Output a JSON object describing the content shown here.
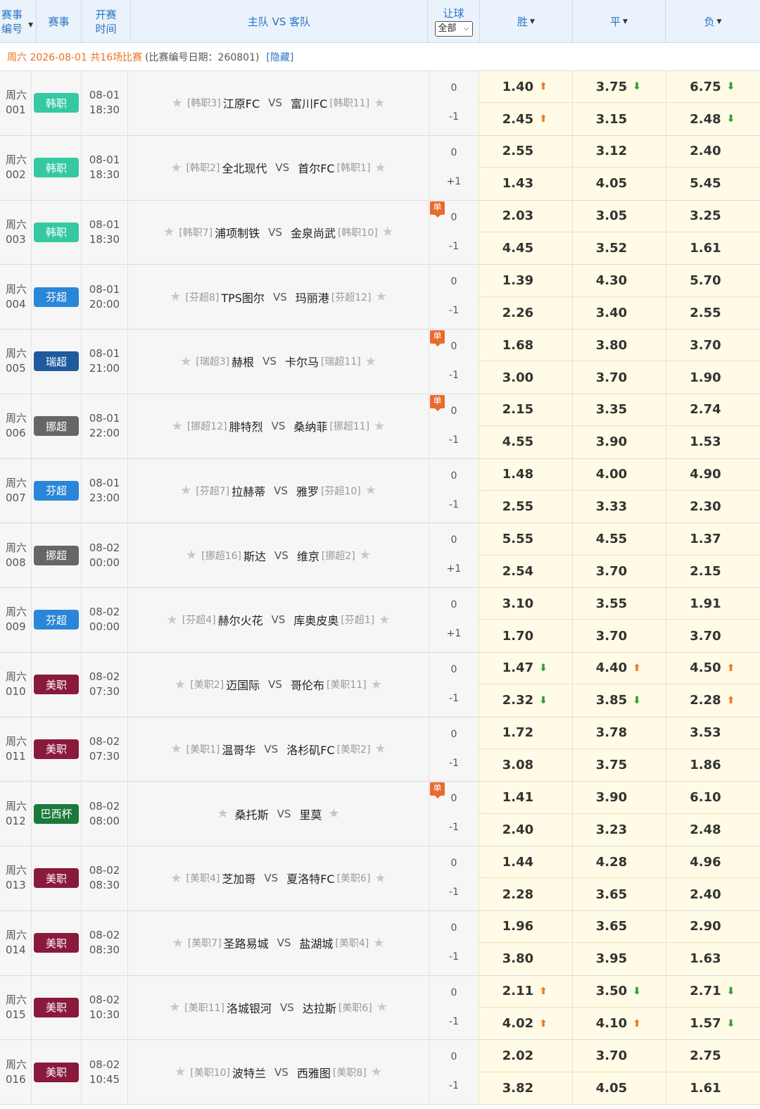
{
  "header": {
    "col_id": "赛事编号",
    "col_league": "赛事",
    "col_time": "开赛时间",
    "col_teams": "主队 VS 客队",
    "col_handicap": "让球",
    "handicap_select": "全部",
    "col_win": "胜",
    "col_draw": "平",
    "col_lose": "负"
  },
  "date_bar": {
    "date_text": "周六 2026-08-01 共16场比赛",
    "id_date_text": "(比赛编号日期：260801)",
    "hide_link": "[隐藏]"
  },
  "vs_label": "VS",
  "single_tag": "单",
  "colors": {
    "header_bg": "#eaf3fb",
    "accent_blue": "#2a73c2",
    "date_orange": "#e8741c",
    "odds_bg": "#fffbe6",
    "arrow_up": "#f07a22",
    "arrow_down": "#2ca02c",
    "single_tag": "#ea6a2e"
  },
  "icons": {
    "star": "star-icon",
    "arrow_up": "arrow-up-icon",
    "arrow_down": "arrow-down-icon",
    "sort": "caret-down-icon"
  },
  "matches": [
    {
      "day": "周六",
      "num": "001",
      "league": "韩职",
      "league_color": "#35c9a3",
      "date": "08-01",
      "time": "18:30",
      "home_rank": "[韩职3]",
      "home": "江原FC",
      "away": "富川FC",
      "away_rank": "[韩职11]",
      "single": false,
      "hcap_top": "0",
      "hcap_bottom": "-1",
      "odds": [
        [
          "1.40",
          "up"
        ],
        [
          "3.75",
          "dn"
        ],
        [
          "6.75",
          "dn"
        ],
        [
          "2.45",
          "up"
        ],
        [
          "3.15",
          ""
        ],
        [
          "2.48",
          "dn"
        ]
      ]
    },
    {
      "day": "周六",
      "num": "002",
      "league": "韩职",
      "league_color": "#35c9a3",
      "date": "08-01",
      "time": "18:30",
      "home_rank": "[韩职2]",
      "home": "全北现代",
      "away": "首尔FC",
      "away_rank": "[韩职1]",
      "single": false,
      "hcap_top": "0",
      "hcap_bottom": "+1",
      "odds": [
        [
          "2.55",
          ""
        ],
        [
          "3.12",
          ""
        ],
        [
          "2.40",
          ""
        ],
        [
          "1.43",
          ""
        ],
        [
          "4.05",
          ""
        ],
        [
          "5.45",
          ""
        ]
      ]
    },
    {
      "day": "周六",
      "num": "003",
      "league": "韩职",
      "league_color": "#35c9a3",
      "date": "08-01",
      "time": "18:30",
      "home_rank": "[韩职7]",
      "home": "浦项制铁",
      "away": "金泉尚武",
      "away_rank": "[韩职10]",
      "single": true,
      "hcap_top": "0",
      "hcap_bottom": "-1",
      "odds": [
        [
          "2.03",
          ""
        ],
        [
          "3.05",
          ""
        ],
        [
          "3.25",
          ""
        ],
        [
          "4.45",
          ""
        ],
        [
          "3.52",
          ""
        ],
        [
          "1.61",
          ""
        ]
      ]
    },
    {
      "day": "周六",
      "num": "004",
      "league": "芬超",
      "league_color": "#2a86d8",
      "date": "08-01",
      "time": "20:00",
      "home_rank": "[芬超8]",
      "home": "TPS图尔",
      "away": "玛丽港",
      "away_rank": "[芬超12]",
      "single": false,
      "hcap_top": "0",
      "hcap_bottom": "-1",
      "odds": [
        [
          "1.39",
          ""
        ],
        [
          "4.30",
          ""
        ],
        [
          "5.70",
          ""
        ],
        [
          "2.26",
          ""
        ],
        [
          "3.40",
          ""
        ],
        [
          "2.55",
          ""
        ]
      ]
    },
    {
      "day": "周六",
      "num": "005",
      "league": "瑞超",
      "league_color": "#1f5a9c",
      "date": "08-01",
      "time": "21:00",
      "home_rank": "[瑞超3]",
      "home": "赫根",
      "away": "卡尔马",
      "away_rank": "[瑞超11]",
      "single": true,
      "hcap_top": "0",
      "hcap_bottom": "-1",
      "odds": [
        [
          "1.68",
          ""
        ],
        [
          "3.80",
          ""
        ],
        [
          "3.70",
          ""
        ],
        [
          "3.00",
          ""
        ],
        [
          "3.70",
          ""
        ],
        [
          "1.90",
          ""
        ]
      ]
    },
    {
      "day": "周六",
      "num": "006",
      "league": "挪超",
      "league_color": "#666666",
      "date": "08-01",
      "time": "22:00",
      "home_rank": "[挪超12]",
      "home": "腓特烈",
      "away": "桑纳菲",
      "away_rank": "[挪超11]",
      "single": true,
      "hcap_top": "0",
      "hcap_bottom": "-1",
      "odds": [
        [
          "2.15",
          ""
        ],
        [
          "3.35",
          ""
        ],
        [
          "2.74",
          ""
        ],
        [
          "4.55",
          ""
        ],
        [
          "3.90",
          ""
        ],
        [
          "1.53",
          ""
        ]
      ]
    },
    {
      "day": "周六",
      "num": "007",
      "league": "芬超",
      "league_color": "#2a86d8",
      "date": "08-01",
      "time": "23:00",
      "home_rank": "[芬超7]",
      "home": "拉赫蒂",
      "away": "雅罗",
      "away_rank": "[芬超10]",
      "single": false,
      "hcap_top": "0",
      "hcap_bottom": "-1",
      "odds": [
        [
          "1.48",
          ""
        ],
        [
          "4.00",
          ""
        ],
        [
          "4.90",
          ""
        ],
        [
          "2.55",
          ""
        ],
        [
          "3.33",
          ""
        ],
        [
          "2.30",
          ""
        ]
      ]
    },
    {
      "day": "周六",
      "num": "008",
      "league": "挪超",
      "league_color": "#666666",
      "date": "08-02",
      "time": "00:00",
      "home_rank": "[挪超16]",
      "home": "斯达",
      "away": "维京",
      "away_rank": "[挪超2]",
      "single": false,
      "hcap_top": "0",
      "hcap_bottom": "+1",
      "odds": [
        [
          "5.55",
          ""
        ],
        [
          "4.55",
          ""
        ],
        [
          "1.37",
          ""
        ],
        [
          "2.54",
          ""
        ],
        [
          "3.70",
          ""
        ],
        [
          "2.15",
          ""
        ]
      ]
    },
    {
      "day": "周六",
      "num": "009",
      "league": "芬超",
      "league_color": "#2a86d8",
      "date": "08-02",
      "time": "00:00",
      "home_rank": "[芬超4]",
      "home": "赫尔火花",
      "away": "库奥皮奥",
      "away_rank": "[芬超1]",
      "single": false,
      "hcap_top": "0",
      "hcap_bottom": "+1",
      "odds": [
        [
          "3.10",
          ""
        ],
        [
          "3.55",
          ""
        ],
        [
          "1.91",
          ""
        ],
        [
          "1.70",
          ""
        ],
        [
          "3.70",
          ""
        ],
        [
          "3.70",
          ""
        ]
      ]
    },
    {
      "day": "周六",
      "num": "010",
      "league": "美职",
      "league_color": "#8a1a3c",
      "date": "08-02",
      "time": "07:30",
      "home_rank": "[美职2]",
      "home": "迈国际",
      "away": "哥伦布",
      "away_rank": "[美职11]",
      "single": false,
      "hcap_top": "0",
      "hcap_bottom": "-1",
      "odds": [
        [
          "1.47",
          "dn"
        ],
        [
          "4.40",
          "up"
        ],
        [
          "4.50",
          "up"
        ],
        [
          "2.32",
          "dn"
        ],
        [
          "3.85",
          "dn"
        ],
        [
          "2.28",
          "up"
        ]
      ]
    },
    {
      "day": "周六",
      "num": "011",
      "league": "美职",
      "league_color": "#8a1a3c",
      "date": "08-02",
      "time": "07:30",
      "home_rank": "[美职1]",
      "home": "温哥华",
      "away": "洛杉矶FC",
      "away_rank": "[美职2]",
      "single": false,
      "hcap_top": "0",
      "hcap_bottom": "-1",
      "odds": [
        [
          "1.72",
          ""
        ],
        [
          "3.78",
          ""
        ],
        [
          "3.53",
          ""
        ],
        [
          "3.08",
          ""
        ],
        [
          "3.75",
          ""
        ],
        [
          "1.86",
          ""
        ]
      ]
    },
    {
      "day": "周六",
      "num": "012",
      "league": "巴西杯",
      "league_color": "#1a7a3a",
      "date": "08-02",
      "time": "08:00",
      "home_rank": "",
      "home": "桑托斯",
      "away": "里莫",
      "away_rank": "",
      "single": true,
      "hcap_top": "0",
      "hcap_bottom": "-1",
      "odds": [
        [
          "1.41",
          ""
        ],
        [
          "3.90",
          ""
        ],
        [
          "6.10",
          ""
        ],
        [
          "2.40",
          ""
        ],
        [
          "3.23",
          ""
        ],
        [
          "2.48",
          ""
        ]
      ]
    },
    {
      "day": "周六",
      "num": "013",
      "league": "美职",
      "league_color": "#8a1a3c",
      "date": "08-02",
      "time": "08:30",
      "home_rank": "[美职4]",
      "home": "芝加哥",
      "away": "夏洛特FC",
      "away_rank": "[美职6]",
      "single": false,
      "hcap_top": "0",
      "hcap_bottom": "-1",
      "odds": [
        [
          "1.44",
          ""
        ],
        [
          "4.28",
          ""
        ],
        [
          "4.96",
          ""
        ],
        [
          "2.28",
          ""
        ],
        [
          "3.65",
          ""
        ],
        [
          "2.40",
          ""
        ]
      ]
    },
    {
      "day": "周六",
      "num": "014",
      "league": "美职",
      "league_color": "#8a1a3c",
      "date": "08-02",
      "time": "08:30",
      "home_rank": "[美职7]",
      "home": "圣路易城",
      "away": "盐湖城",
      "away_rank": "[美职4]",
      "single": false,
      "hcap_top": "0",
      "hcap_bottom": "-1",
      "odds": [
        [
          "1.96",
          ""
        ],
        [
          "3.65",
          ""
        ],
        [
          "2.90",
          ""
        ],
        [
          "3.80",
          ""
        ],
        [
          "3.95",
          ""
        ],
        [
          "1.63",
          ""
        ]
      ]
    },
    {
      "day": "周六",
      "num": "015",
      "league": "美职",
      "league_color": "#8a1a3c",
      "date": "08-02",
      "time": "10:30",
      "home_rank": "[美职11]",
      "home": "洛城银河",
      "away": "达拉斯",
      "away_rank": "[美职6]",
      "single": false,
      "hcap_top": "0",
      "hcap_bottom": "-1",
      "odds": [
        [
          "2.11",
          "up"
        ],
        [
          "3.50",
          "dn"
        ],
        [
          "2.71",
          "dn"
        ],
        [
          "4.02",
          "up"
        ],
        [
          "4.10",
          "up"
        ],
        [
          "1.57",
          "dn"
        ]
      ]
    },
    {
      "day": "周六",
      "num": "016",
      "league": "美职",
      "league_color": "#8a1a3c",
      "date": "08-02",
      "time": "10:45",
      "home_rank": "[美职10]",
      "home": "波特兰",
      "away": "西雅图",
      "away_rank": "[美职8]",
      "single": false,
      "hcap_top": "0",
      "hcap_bottom": "-1",
      "odds": [
        [
          "2.02",
          ""
        ],
        [
          "3.70",
          ""
        ],
        [
          "2.75",
          ""
        ],
        [
          "3.82",
          ""
        ],
        [
          "4.05",
          ""
        ],
        [
          "1.61",
          ""
        ]
      ]
    }
  ]
}
